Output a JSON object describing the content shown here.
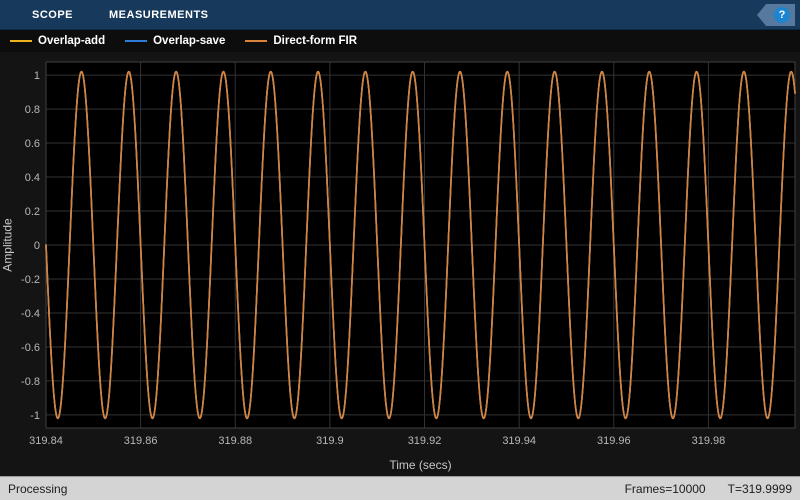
{
  "toolbar": {
    "tabs": [
      {
        "label": "SCOPE"
      },
      {
        "label": "MEASUREMENTS"
      }
    ],
    "help_label": "?"
  },
  "legend": {
    "items": [
      {
        "label": "Overlap-add",
        "color": "#edb120"
      },
      {
        "label": "Overlap-save",
        "color": "#2e7cd6"
      },
      {
        "label": "Direct-form FIR",
        "color": "#d9823b"
      }
    ]
  },
  "status": {
    "left": "Processing",
    "frames": "Frames=10000",
    "time": "T=319.9999"
  },
  "chart_data": {
    "type": "line",
    "title": "",
    "xlabel": "Time (secs)",
    "ylabel": "Amplitude",
    "xlim": [
      319.84,
      319.9983
    ],
    "ylim": [
      -1.077,
      1.077
    ],
    "xticks": [
      319.84,
      319.86,
      319.88,
      319.9,
      319.92,
      319.94,
      319.96,
      319.98
    ],
    "xtick_labels": [
      "319.84",
      "319.86",
      "319.88",
      "319.9",
      "319.92",
      "319.94",
      "319.96",
      "319.98"
    ],
    "yticks": [
      -1,
      -0.8,
      -0.6,
      -0.4,
      -0.2,
      0,
      0.2,
      0.4,
      0.6,
      0.8,
      1
    ],
    "ytick_labels": [
      "-1",
      "-0.8",
      "-0.6",
      "-0.4",
      "-0.2",
      "0",
      "0.2",
      "0.4",
      "0.6",
      "0.8",
      "1"
    ],
    "grid": true,
    "legend_position": "top-bar",
    "background": "#000000",
    "grid_color": "#333333",
    "axis_border_color": "#3f3f3f",
    "tick_label_color": "#b8b8b8",
    "series": [
      {
        "name": "Overlap-add",
        "color": "#edb120",
        "waveform": "sine",
        "amplitude": 1.02,
        "frequency_hz": 100,
        "phase_at_xstart_rad": 3.14159265
      },
      {
        "name": "Overlap-save",
        "color": "#2e7cd6",
        "waveform": "sine",
        "amplitude": 1.02,
        "frequency_hz": 100,
        "phase_at_xstart_rad": 3.14159265
      },
      {
        "name": "Direct-form FIR",
        "color": "#d9823b",
        "waveform": "sine",
        "amplitude": 1.02,
        "frequency_hz": 100,
        "phase_at_xstart_rad": 3.14159265
      }
    ]
  }
}
